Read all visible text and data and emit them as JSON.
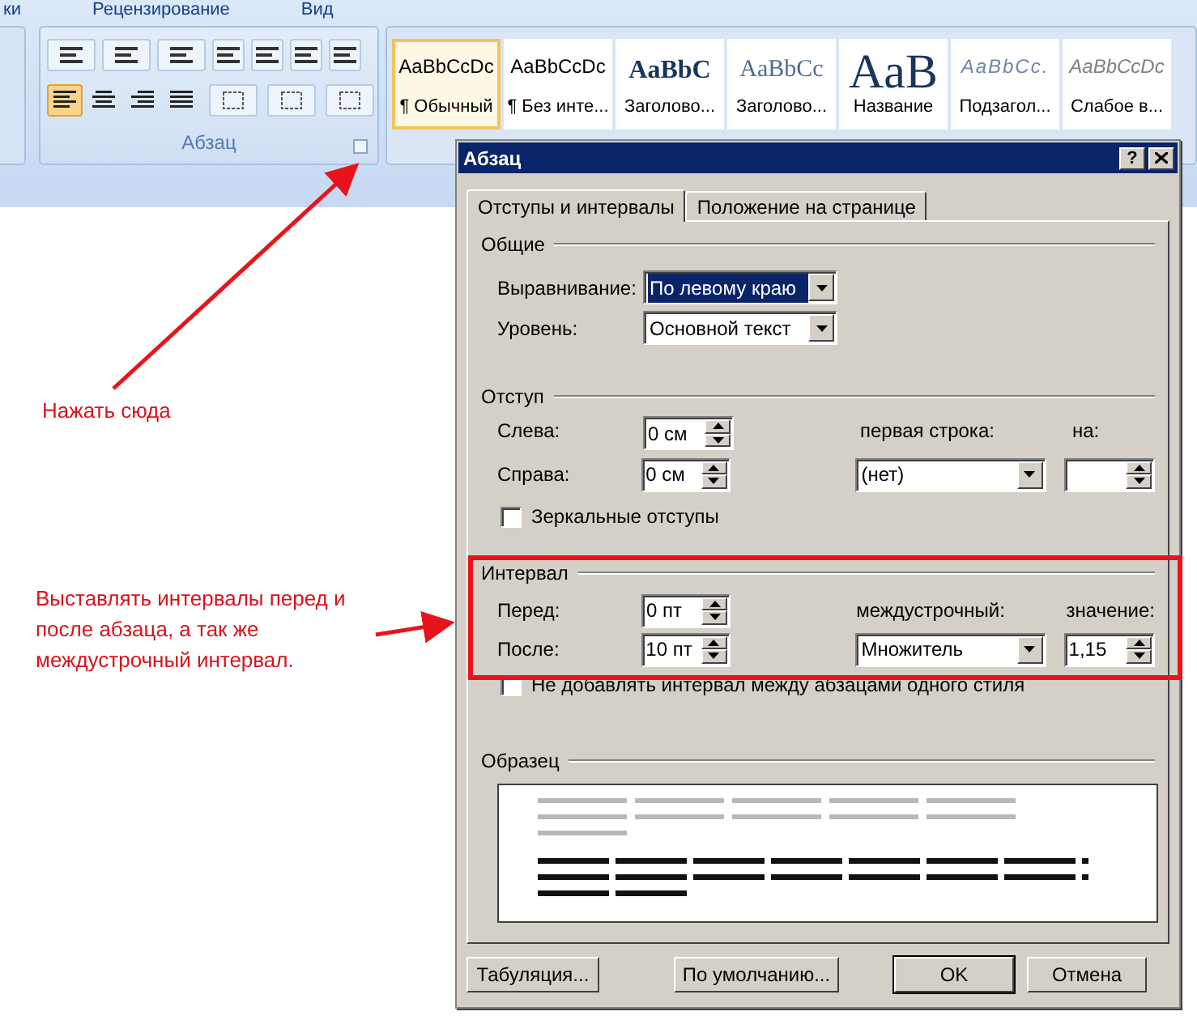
{
  "ribbon_tabs": [
    {
      "label": "ки"
    },
    {
      "label": "Рецензирование"
    },
    {
      "label": "Вид"
    }
  ],
  "paragraph_group": {
    "label": "Абзац",
    "align_buttons": [
      {
        "kind": "left",
        "selected": true
      },
      {
        "kind": "center",
        "selected": false
      },
      {
        "kind": "right",
        "selected": false
      },
      {
        "kind": "justify",
        "selected": false
      }
    ]
  },
  "styles": [
    {
      "kind": "normal",
      "preview": "AaBbCcDc",
      "name": "¶ Обычный",
      "selected": true
    },
    {
      "kind": "normal",
      "preview": "AaBbCcDc",
      "name": "¶ Без инте...",
      "selected": false
    },
    {
      "kind": "heading1",
      "preview": "AaBbC",
      "name": "Заголово...",
      "selected": false
    },
    {
      "kind": "heading2",
      "preview": "AaBbCc",
      "name": "Заголово...",
      "selected": false
    },
    {
      "kind": "title",
      "preview": "AaB",
      "name": "Название",
      "selected": false
    },
    {
      "kind": "subtitle",
      "preview": "AaBbCc.",
      "name": "Подзагол...",
      "selected": false
    },
    {
      "kind": "subtle",
      "preview": "AaBbCcDc",
      "name": "Слабое в...",
      "selected": false
    }
  ],
  "dialog": {
    "title": "Абзац",
    "help": "?",
    "tabs": [
      {
        "label": "Отступы и интервалы",
        "selected": true
      },
      {
        "label": "Положение на странице",
        "selected": false
      }
    ],
    "general": {
      "heading": "Общие",
      "rows": [
        {
          "label": "Выравнивание:",
          "value": "По левому краю",
          "highlighted": true
        },
        {
          "label": "Уровень:",
          "value": "Основной текст",
          "highlighted": false
        }
      ]
    },
    "indent": {
      "heading": "Отступ",
      "left": {
        "label": "Слева:",
        "value": "0 см"
      },
      "right": {
        "label": "Справа:",
        "value": "0 см"
      },
      "first_line": {
        "label": "первая строка:",
        "value": "(нет)"
      },
      "by": {
        "label": "на:"
      },
      "mirror": {
        "label": "Зеркальные отступы",
        "checked": false
      }
    },
    "spacing": {
      "heading": "Интервал",
      "before": {
        "label": "Перед:",
        "value": "0 пт"
      },
      "after": {
        "label": "После:",
        "value": "10 пт"
      },
      "line": {
        "label": "междустрочный:",
        "value": "Множитель"
      },
      "at": {
        "label": "значение:",
        "value": "1,15"
      },
      "no_space": {
        "label": "Не добавлять интервал между абзацами одного стиля",
        "checked": false
      }
    },
    "sample": {
      "heading": "Образец"
    },
    "buttons": [
      {
        "label": "Табуляция...",
        "kind": "normal"
      },
      {
        "label": "По умолчанию...",
        "kind": "normal"
      },
      {
        "label": "OK",
        "kind": "default"
      },
      {
        "label": "Отмена",
        "kind": "normal"
      }
    ]
  },
  "annotations": [
    {
      "text": "Нажать сюда"
    },
    {
      "text": "Выставлять интервалы перед и после абзаца, а так же междустрочный интервал."
    }
  ]
}
